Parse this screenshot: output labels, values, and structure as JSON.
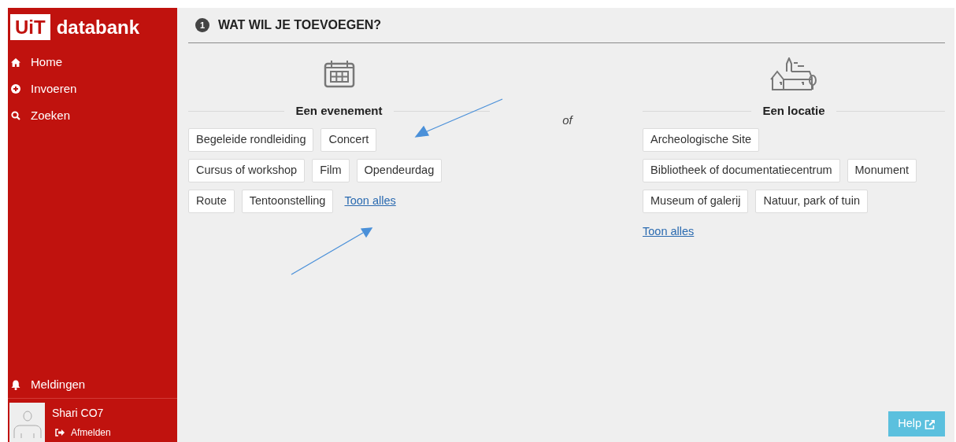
{
  "logo": {
    "mark": "UiT",
    "name": "databank"
  },
  "nav": [
    {
      "kind": "home",
      "label": "Home"
    },
    {
      "kind": "add",
      "label": "Invoeren"
    },
    {
      "kind": "search",
      "label": "Zoeken"
    }
  ],
  "notifications": {
    "label": "Meldingen"
  },
  "user": {
    "name": "Shari CO7",
    "logout": "Afmelden"
  },
  "step": {
    "number": "1",
    "title": "WAT WIL JE TOEVOEGEN?"
  },
  "sections": [
    {
      "kind": "event",
      "title": "Een evenement",
      "rows": [
        [
          {
            "kind": "tag",
            "label": "Begeleide rondleiding"
          },
          {
            "kind": "tag",
            "label": "Concert"
          }
        ],
        [
          {
            "kind": "tag",
            "label": "Cursus of workshop"
          },
          {
            "kind": "tag",
            "label": "Film"
          },
          {
            "kind": "tag",
            "label": "Opendeurdag"
          }
        ],
        [
          {
            "kind": "tag",
            "label": "Route"
          },
          {
            "kind": "tag",
            "label": "Tentoonstelling"
          },
          {
            "kind": "link",
            "label": "Toon alles"
          }
        ]
      ]
    },
    {
      "kind": "location",
      "title": "Een locatie",
      "rows": [
        [
          {
            "kind": "tag",
            "label": "Archeologische Site"
          }
        ],
        [
          {
            "kind": "tag",
            "label": "Bibliotheek of documentatiecentrum"
          },
          {
            "kind": "tag",
            "label": "Monument"
          }
        ],
        [
          {
            "kind": "tag",
            "label": "Museum of galerij"
          },
          {
            "kind": "tag",
            "label": "Natuur, park of tuin"
          }
        ],
        [
          {
            "kind": "link",
            "label": "Toon alles"
          }
        ]
      ]
    }
  ],
  "separator": "of",
  "help": {
    "label": "Help"
  }
}
